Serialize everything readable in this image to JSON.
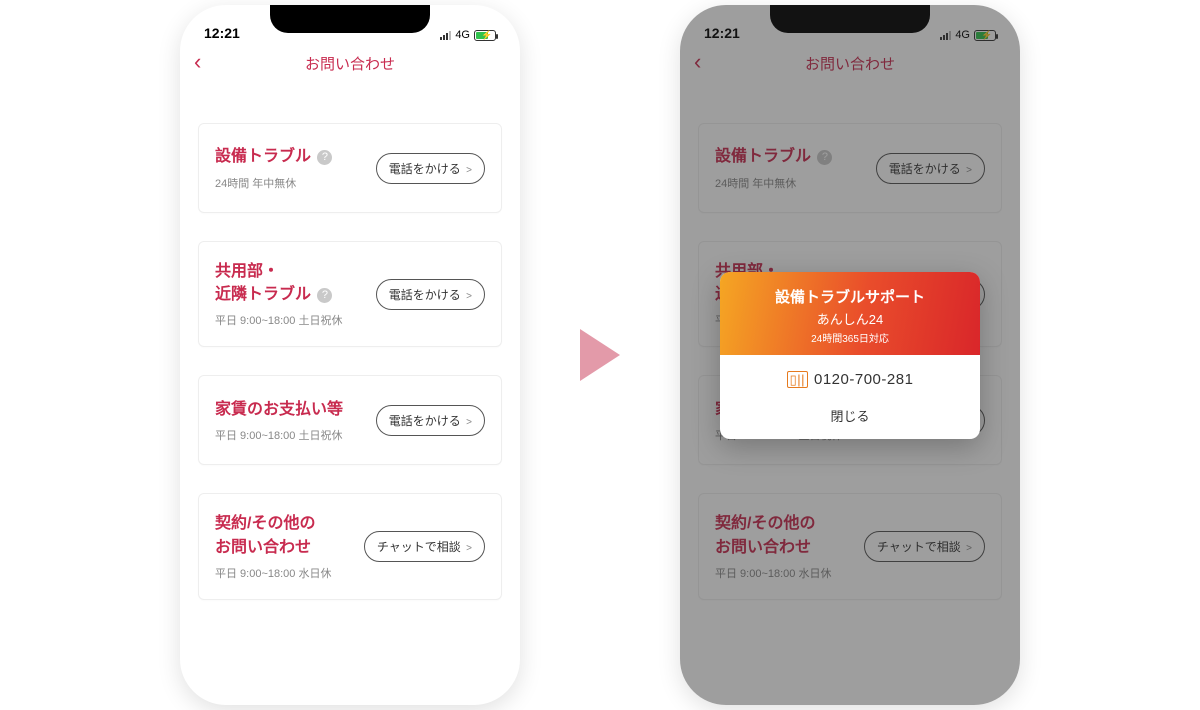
{
  "status": {
    "time": "12:21",
    "network": "4G"
  },
  "nav": {
    "title": "お問い合わせ",
    "back_glyph": "‹"
  },
  "cards": [
    {
      "title": "設備トラブル",
      "help": true,
      "sub": "24時間 年中無休",
      "button": "電話をかける"
    },
    {
      "title": "共用部・\n近隣トラブル",
      "help": true,
      "sub": "平日 9:00~18:00 土日祝休",
      "button": "電話をかける"
    },
    {
      "title": "家賃のお支払い等",
      "help": false,
      "sub": "平日 9:00~18:00 土日祝休",
      "button": "電話をかける"
    },
    {
      "title": "契約/その他の\nお問い合わせ",
      "help": false,
      "sub": "平日 9:00~18:00 水日休",
      "button": "チャットで相談"
    }
  ],
  "popup": {
    "title": "設備トラブルサポート",
    "name": "あんしん24",
    "hours": "24時間365日対応",
    "phone": "0120-700-281",
    "close": "閉じる"
  }
}
